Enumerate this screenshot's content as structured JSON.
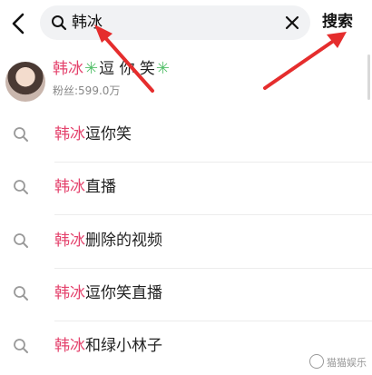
{
  "search": {
    "query_text": "韩冰",
    "button_label": "搜索"
  },
  "user_result": {
    "name_highlight": "韩冰",
    "name_part1": "逗",
    "name_part2": "你",
    "name_part3": "笑",
    "spark": "✳",
    "followers": "粉丝:599.0万"
  },
  "suggestions": [
    {
      "highlight": "韩冰",
      "rest": "逗你笑"
    },
    {
      "highlight": "韩冰",
      "rest": "直播"
    },
    {
      "highlight": "韩冰",
      "rest": "删除的视频"
    },
    {
      "highlight": "韩冰",
      "rest": "逗你笑直播"
    },
    {
      "highlight": "韩冰",
      "rest": "和绿小林子"
    }
  ],
  "watermark": {
    "text": "猫猫娱乐"
  },
  "colors": {
    "highlight": "#e4436d",
    "arrow": "#e52d2d",
    "spark": "#56c06c"
  }
}
